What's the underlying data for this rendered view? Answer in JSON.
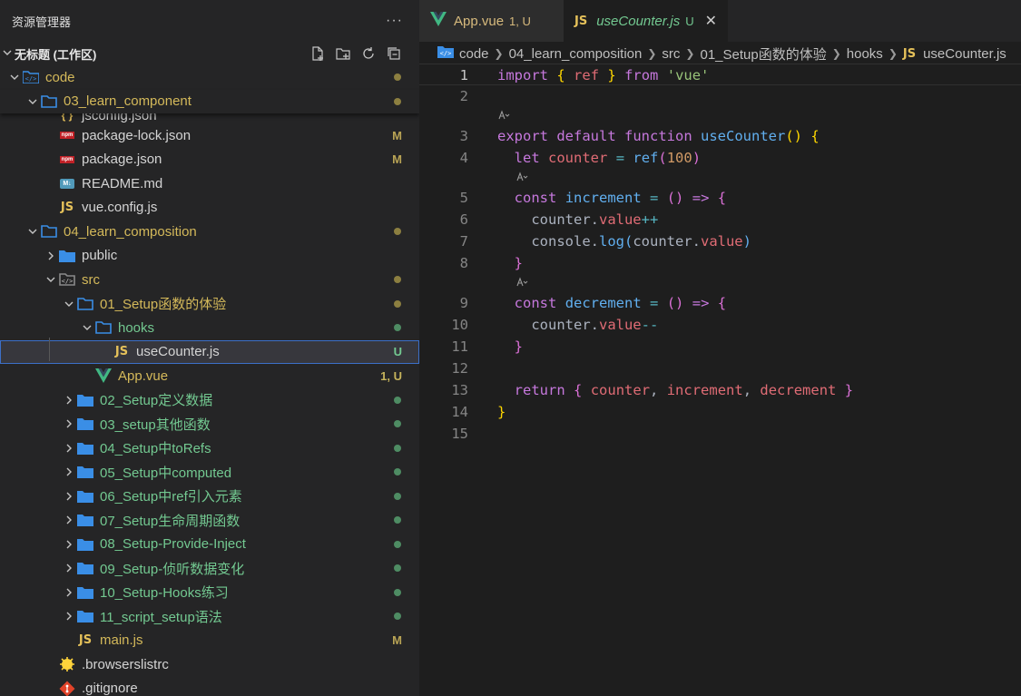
{
  "sidebar": {
    "title": "资源管理器",
    "more": "···",
    "workspace": "无标题 (工作区)",
    "tree": [
      {
        "label": "code",
        "depth": 0,
        "type": "folder-root",
        "expanded": true,
        "color": "yellow",
        "dot": "yellow"
      },
      {
        "label": "03_learn_component",
        "depth": 1,
        "type": "folder",
        "expanded": true,
        "color": "yellow",
        "dot": "yellow",
        "sticky": true
      },
      {
        "label": "jsconfig.json",
        "depth": 2,
        "type": "json",
        "color": "white",
        "partial": true
      },
      {
        "label": "package-lock.json",
        "depth": 2,
        "type": "npm",
        "color": "white",
        "badge": "M"
      },
      {
        "label": "package.json",
        "depth": 2,
        "type": "npm",
        "color": "white",
        "badge": "M"
      },
      {
        "label": "README.md",
        "depth": 2,
        "type": "md",
        "color": "white"
      },
      {
        "label": "vue.config.js",
        "depth": 2,
        "type": "js",
        "color": "white"
      },
      {
        "label": "04_learn_composition",
        "depth": 1,
        "type": "folder",
        "expanded": true,
        "color": "yellow",
        "dot": "yellow"
      },
      {
        "label": "public",
        "depth": 2,
        "type": "folder-closed",
        "expanded": false,
        "color": "white"
      },
      {
        "label": "src",
        "depth": 2,
        "type": "folder-src",
        "expanded": true,
        "color": "yellow",
        "dot": "yellow"
      },
      {
        "label": "01_Setup函数的体验",
        "depth": 3,
        "type": "folder",
        "expanded": true,
        "color": "yellow",
        "dot": "yellow"
      },
      {
        "label": "hooks",
        "depth": 4,
        "type": "folder",
        "expanded": true,
        "color": "green",
        "dot": "green"
      },
      {
        "label": "useCounter.js",
        "depth": 5,
        "type": "js",
        "color": "white",
        "badge": "U",
        "selected": true
      },
      {
        "label": "App.vue",
        "depth": 4,
        "type": "vue",
        "color": "yellow",
        "badge": "1, U"
      },
      {
        "label": "02_Setup定义数据",
        "depth": 3,
        "type": "folder-closed",
        "expanded": false,
        "color": "green",
        "dot": "green"
      },
      {
        "label": "03_setup其他函数",
        "depth": 3,
        "type": "folder-closed",
        "expanded": false,
        "color": "green",
        "dot": "green"
      },
      {
        "label": "04_Setup中toRefs",
        "depth": 3,
        "type": "folder-closed",
        "expanded": false,
        "color": "green",
        "dot": "green"
      },
      {
        "label": "05_Setup中computed",
        "depth": 3,
        "type": "folder-closed",
        "expanded": false,
        "color": "green",
        "dot": "green"
      },
      {
        "label": "06_Setup中ref引入元素",
        "depth": 3,
        "type": "folder-closed",
        "expanded": false,
        "color": "green",
        "dot": "green"
      },
      {
        "label": "07_Setup生命周期函数",
        "depth": 3,
        "type": "folder-closed",
        "expanded": false,
        "color": "green",
        "dot": "green"
      },
      {
        "label": "08_Setup-Provide-Inject",
        "depth": 3,
        "type": "folder-closed",
        "expanded": false,
        "color": "green",
        "dot": "green"
      },
      {
        "label": "09_Setup-侦听数据变化",
        "depth": 3,
        "type": "folder-closed",
        "expanded": false,
        "color": "green",
        "dot": "green"
      },
      {
        "label": "10_Setup-Hooks练习",
        "depth": 3,
        "type": "folder-closed",
        "expanded": false,
        "color": "green",
        "dot": "green"
      },
      {
        "label": "11_script_setup语法",
        "depth": 3,
        "type": "folder-closed",
        "expanded": false,
        "color": "green",
        "dot": "green"
      },
      {
        "label": "main.js",
        "depth": 3,
        "type": "js",
        "color": "yellow",
        "badge": "M"
      },
      {
        "label": ".browserslistrc",
        "depth": 2,
        "type": "browsers",
        "color": "white"
      },
      {
        "label": ".gitignore",
        "depth": 2,
        "type": "git",
        "color": "white"
      }
    ]
  },
  "tabs": [
    {
      "label": "App.vue",
      "status": "1, U",
      "type": "vue",
      "active": false
    },
    {
      "label": "useCounter.js",
      "status": "U",
      "type": "js",
      "active": true,
      "close": "✕"
    }
  ],
  "breadcrumb": [
    "code",
    "04_learn_composition",
    "src",
    "01_Setup函数的体验",
    "hooks",
    "useCounter.js"
  ],
  "colors": {
    "accent": "#3c6fc8",
    "modified": "#b9a455",
    "untracked": "#73c991"
  },
  "code": {
    "lines": [
      {
        "n": "1",
        "t": [
          [
            "k",
            "import"
          ],
          [
            "p",
            " "
          ],
          [
            "br",
            "{"
          ],
          [
            "p",
            " "
          ],
          [
            "v",
            "ref"
          ],
          [
            "p",
            " "
          ],
          [
            "br",
            "}"
          ],
          [
            "p",
            " "
          ],
          [
            "k",
            "from"
          ],
          [
            "p",
            " "
          ],
          [
            "s",
            "'vue'"
          ]
        ],
        "current": true
      },
      {
        "n": "2",
        "t": []
      },
      {
        "lens": true
      },
      {
        "n": "3",
        "t": [
          [
            "k",
            "export"
          ],
          [
            "p",
            " "
          ],
          [
            "k",
            "default"
          ],
          [
            "p",
            " "
          ],
          [
            "k",
            "function"
          ],
          [
            "p",
            " "
          ],
          [
            "f",
            "useCounter"
          ],
          [
            "br",
            "()"
          ],
          [
            "p",
            " "
          ],
          [
            "br",
            "{"
          ]
        ]
      },
      {
        "n": "4",
        "t": [
          [
            "p",
            "  "
          ],
          [
            "k",
            "let"
          ],
          [
            "p",
            " "
          ],
          [
            "v",
            "counter"
          ],
          [
            "p",
            " "
          ],
          [
            "o",
            "="
          ],
          [
            "p",
            " "
          ],
          [
            "f",
            "ref"
          ],
          [
            "br2",
            "("
          ],
          [
            "n",
            "100"
          ],
          [
            "br2",
            ")"
          ]
        ]
      },
      {
        "lens": true,
        "indent": 1
      },
      {
        "n": "5",
        "t": [
          [
            "p",
            "  "
          ],
          [
            "k",
            "const"
          ],
          [
            "p",
            " "
          ],
          [
            "f",
            "increment"
          ],
          [
            "p",
            " "
          ],
          [
            "o",
            "="
          ],
          [
            "p",
            " "
          ],
          [
            "br2",
            "()"
          ],
          [
            "p",
            " "
          ],
          [
            "k",
            "=>"
          ],
          [
            "p",
            " "
          ],
          [
            "br2",
            "{"
          ]
        ]
      },
      {
        "n": "6",
        "t": [
          [
            "p",
            "    "
          ],
          [
            "p",
            "counter."
          ],
          [
            "v",
            "value"
          ],
          [
            "o",
            "++"
          ]
        ]
      },
      {
        "n": "7",
        "t": [
          [
            "p",
            "    "
          ],
          [
            "p",
            "console."
          ],
          [
            "f",
            "log"
          ],
          [
            "kb",
            "("
          ],
          [
            "p",
            "counter."
          ],
          [
            "v",
            "value"
          ],
          [
            "kb",
            ")"
          ]
        ]
      },
      {
        "n": "8",
        "t": [
          [
            "p",
            "  "
          ],
          [
            "br2",
            "}"
          ]
        ]
      },
      {
        "lens": true,
        "indent": 1
      },
      {
        "n": "9",
        "t": [
          [
            "p",
            "  "
          ],
          [
            "k",
            "const"
          ],
          [
            "p",
            " "
          ],
          [
            "f",
            "decrement"
          ],
          [
            "p",
            " "
          ],
          [
            "o",
            "="
          ],
          [
            "p",
            " "
          ],
          [
            "br2",
            "()"
          ],
          [
            "p",
            " "
          ],
          [
            "k",
            "=>"
          ],
          [
            "p",
            " "
          ],
          [
            "br2",
            "{"
          ]
        ]
      },
      {
        "n": "10",
        "t": [
          [
            "p",
            "    "
          ],
          [
            "p",
            "counter."
          ],
          [
            "v",
            "value"
          ],
          [
            "o",
            "--"
          ]
        ]
      },
      {
        "n": "11",
        "t": [
          [
            "p",
            "  "
          ],
          [
            "br2",
            "}"
          ]
        ]
      },
      {
        "n": "12",
        "t": []
      },
      {
        "n": "13",
        "t": [
          [
            "p",
            "  "
          ],
          [
            "k",
            "return"
          ],
          [
            "p",
            " "
          ],
          [
            "br2",
            "{"
          ],
          [
            "p",
            " "
          ],
          [
            "v",
            "counter"
          ],
          [
            "p",
            ", "
          ],
          [
            "v",
            "increment"
          ],
          [
            "p",
            ", "
          ],
          [
            "v",
            "decrement"
          ],
          [
            "p",
            " "
          ],
          [
            "br2",
            "}"
          ]
        ]
      },
      {
        "n": "14",
        "t": [
          [
            "br",
            "}"
          ]
        ]
      },
      {
        "n": "15",
        "t": []
      }
    ]
  }
}
